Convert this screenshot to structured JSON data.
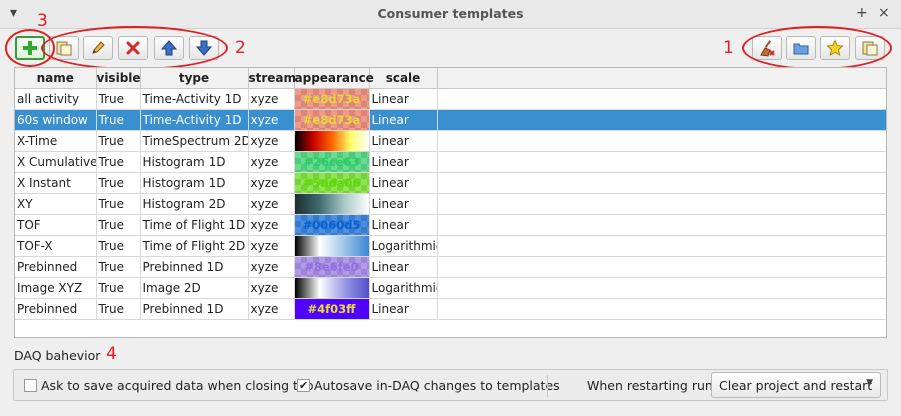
{
  "window": {
    "title": "Consumer templates",
    "menu_glyph": "▾",
    "float_glyph": "+",
    "close_glyph": "×"
  },
  "toolbar_left": [
    {
      "name": "add-template-button",
      "icon": "plus-icon"
    },
    {
      "name": "duplicate-template-button",
      "icon": "copy-icon"
    },
    {
      "name": "edit-template-button",
      "icon": "pencil-icon"
    },
    {
      "name": "delete-template-button",
      "icon": "delete-x-icon"
    },
    {
      "name": "move-up-button",
      "icon": "arrow-up-icon"
    },
    {
      "name": "move-down-button",
      "icon": "arrow-down-icon"
    }
  ],
  "toolbar_right": [
    {
      "name": "clear-templates-button",
      "icon": "broom-icon"
    },
    {
      "name": "load-templates-button",
      "icon": "folder-icon"
    },
    {
      "name": "favorite-templates-button",
      "icon": "star-icon"
    },
    {
      "name": "copy-templates-button",
      "icon": "copy-icon"
    }
  ],
  "annotations": {
    "label_1": "1",
    "label_2": "2",
    "label_3": "3",
    "label_4": "4"
  },
  "table": {
    "columns": [
      "name",
      "visible",
      "type",
      "stream",
      "appearance",
      "scale"
    ],
    "rows": [
      {
        "name": "all activity",
        "visible": "True",
        "type": "Time-Activity 1D",
        "stream": "xyze",
        "appearance": {
          "kind": "checker",
          "color": "#e8705a",
          "text": "#e8d73a"
        },
        "scale": "Linear"
      },
      {
        "name": "60s window",
        "visible": "True",
        "type": "Time-Activity 1D",
        "stream": "xyze",
        "appearance": {
          "kind": "checker",
          "color": "#e8705a",
          "text": "#e8d73a"
        },
        "scale": "Linear",
        "selected": true
      },
      {
        "name": "X-Time",
        "visible": "True",
        "type": "TimeSpectrum 2D",
        "stream": "xyze",
        "appearance": {
          "kind": "gradient",
          "stops": [
            "#000000",
            "#cc0000",
            "#ff6600",
            "#ffff66",
            "#ffffff"
          ]
        },
        "scale": "Linear"
      },
      {
        "name": "X Cumulative",
        "visible": "True",
        "type": "Histogram 1D",
        "stream": "xyze",
        "appearance": {
          "kind": "checker",
          "color": "#26ce63",
          "text": "#26ce63"
        },
        "scale": "Linear"
      },
      {
        "name": "X Instant",
        "visible": "True",
        "type": "Histogram 1D",
        "stream": "xyze",
        "appearance": {
          "kind": "checker",
          "color": "#5dda06",
          "text": "#5dda06"
        },
        "scale": "Linear"
      },
      {
        "name": "XY",
        "visible": "True",
        "type": "Histogram 2D",
        "stream": "xyze",
        "appearance": {
          "kind": "gradient",
          "stops": [
            "#1f2d30",
            "#3f6b70",
            "#a9c8c8",
            "#ffffff"
          ]
        },
        "scale": "Linear"
      },
      {
        "name": "TOF",
        "visible": "True",
        "type": "Time of Flight 1D",
        "stream": "xyze",
        "appearance": {
          "kind": "checker",
          "color": "#0060d5",
          "text": "#0060d5"
        },
        "scale": "Linear"
      },
      {
        "name": "TOF-X",
        "visible": "True",
        "type": "Time of Flight 2D",
        "stream": "xyze",
        "appearance": {
          "kind": "gradient",
          "stops": [
            "#000000",
            "#ffffff",
            "#9fc6e8",
            "#3a86d6"
          ]
        },
        "scale": "Logarithmic"
      },
      {
        "name": "Prebinned",
        "visible": "True",
        "type": "Prebinned 1D",
        "stream": "xyze",
        "appearance": {
          "kind": "checker",
          "color": "#8e6fe0",
          "text": "#8e6fe0"
        },
        "scale": "Linear"
      },
      {
        "name": "Image XYZ",
        "visible": "True",
        "type": "Image 2D",
        "stream": "xyze",
        "appearance": {
          "kind": "gradient",
          "stops": [
            "#000000",
            "#ffffff",
            "#9a9ae6",
            "#5050c8"
          ]
        },
        "scale": "Logarithmic"
      },
      {
        "name": "Prebinned",
        "visible": "True",
        "type": "Prebinned 1D",
        "stream": "xyze",
        "appearance": {
          "kind": "solid",
          "color": "#4f03ff",
          "text": "#4f03ff",
          "text_color": "#e8e030"
        },
        "scale": "Linear"
      }
    ]
  },
  "daq": {
    "label": "DAQ bahevior",
    "ask_save": {
      "label": "Ask to save acquired data when closing tab",
      "checked": false
    },
    "autosave": {
      "label": "Autosave in-DAQ changes to templates",
      "checked": true
    },
    "restart_label": "When restarting run:",
    "restart_value": "Clear project and restart"
  },
  "colors": {
    "selection": "#3a8fcf",
    "annotation": "#e02020"
  }
}
